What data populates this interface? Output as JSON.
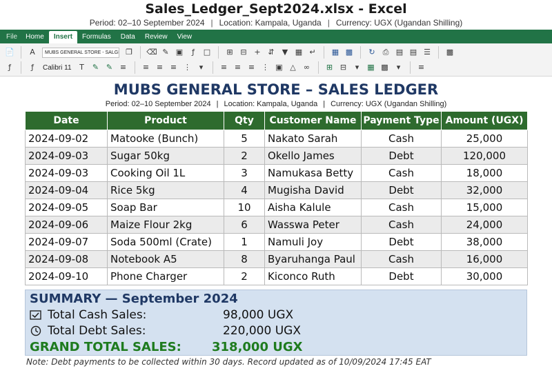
{
  "window": {
    "title": "Sales_Ledger_Sept2024.xlsx - Excel",
    "subtitle": {
      "period": "Period: 02–10 September 2024",
      "location": "Location: Kampala, Uganda",
      "currency": "Currency: UGX (Ugandan Shilling)",
      "separator": "|"
    }
  },
  "ribbon": {
    "tabs": [
      "File",
      "Home",
      "Insert",
      "Formulas",
      "Data",
      "Review",
      "View"
    ],
    "active_tab": "Insert",
    "name_box": "MUBS GENERAL STORE - SALGER",
    "font_name": "Calibri 11"
  },
  "sheet": {
    "title": "MUBS GENERAL STORE – SALES LEDGER",
    "subtitle": {
      "period": "Period: 02–10 September 2024",
      "location": "Location: Kampala, Uganda",
      "currency": "Currency: UGX (Ugandan Shilling)",
      "separator": "|"
    }
  },
  "table": {
    "headers": [
      "Date",
      "Product",
      "Qty",
      "Customer Name",
      "Payment Type",
      "Amount (UGX)"
    ],
    "rows": [
      [
        "2024-09-02",
        "Matooke (Bunch)",
        "5",
        "Nakato Sarah",
        "Cash",
        "25,000"
      ],
      [
        "2024-09-03",
        "Sugar 50kg",
        "2",
        "Okello James",
        "Debt",
        "120,000"
      ],
      [
        "2024-09-03",
        "Cooking Oil 1L",
        "3",
        "Namukasa Betty",
        "Cash",
        "18,000"
      ],
      [
        "2024-09-04",
        "Rice 5kg",
        "4",
        "Mugisha David",
        "Debt",
        "32,000"
      ],
      [
        "2024-09-05",
        "Soap Bar",
        "10",
        "Aisha Kalule",
        "Cash",
        "15,000"
      ],
      [
        "2024-09-06",
        "Maize Flour 2kg",
        "6",
        "Wasswa Peter",
        "Cash",
        "24,000"
      ],
      [
        "2024-09-07",
        "Soda 500ml (Crate)",
        "1",
        "Namuli Joy",
        "Debt",
        "38,000"
      ],
      [
        "2024-09-08",
        "Notebook A5",
        "8",
        "Byaruhanga Paul",
        "Cash",
        "16,000"
      ],
      [
        "2024-09-10",
        "Phone Charger",
        "2",
        "Kiconco Ruth",
        "Debt",
        "30,000"
      ]
    ]
  },
  "summary": {
    "heading": "SUMMARY — September 2024",
    "cash_label": "Total Cash Sales:",
    "cash_value": "98,000 UGX",
    "cash_icon": "checkbox-icon",
    "debt_label": "Total Debt Sales:",
    "debt_value": "220,000 UGX",
    "debt_icon": "clock-icon",
    "grand_label": "GRAND TOTAL SALES:",
    "grand_value": "318,000 UGX"
  },
  "note": "Note: Debt payments to be collected within 30 days. Record updated as of 10/09/2024 17:45 EAT",
  "colors": {
    "ribbon_green": "#217346",
    "header_green": "#2e6b2e",
    "title_navy": "#1f3864",
    "summary_bg": "#d4e1f0",
    "grand_total_green": "#1e7b1e"
  }
}
